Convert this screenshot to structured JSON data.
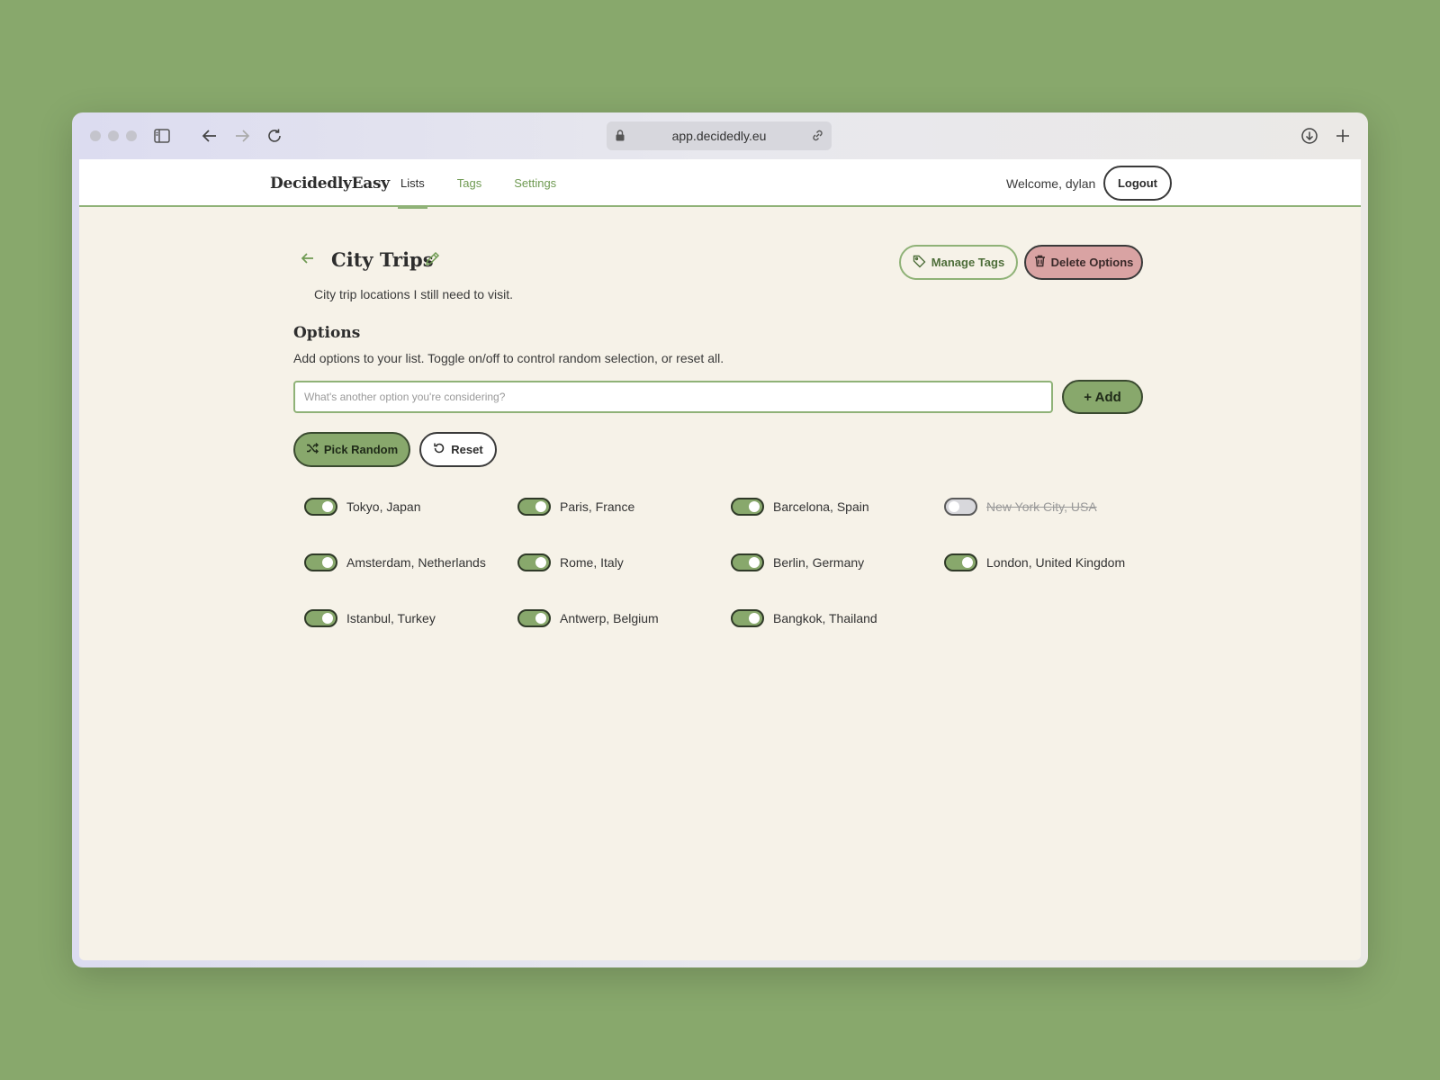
{
  "browser": {
    "url": "app.decidedly.eu"
  },
  "header": {
    "brand": "DecidedlyEasy",
    "nav": [
      {
        "label": "Lists",
        "active": true
      },
      {
        "label": "Tags",
        "active": false
      },
      {
        "label": "Settings",
        "active": false
      }
    ],
    "welcome": "Welcome, dylan",
    "logout_label": "Logout"
  },
  "list": {
    "title": "City Trips",
    "description": "City trip locations I still need to visit.",
    "manage_tags_label": "Manage Tags",
    "delete_options_label": "Delete Options"
  },
  "options_section": {
    "title": "Options",
    "help": "Add options to your list. Toggle on/off to control random selection, or reset all.",
    "input_placeholder": "What's another option you're considering?",
    "add_label": "+ Add",
    "pick_random_label": "Pick Random",
    "reset_label": "Reset"
  },
  "options": [
    {
      "label": "Tokyo, Japan",
      "enabled": true
    },
    {
      "label": "Paris, France",
      "enabled": true
    },
    {
      "label": "Barcelona, Spain",
      "enabled": true
    },
    {
      "label": "New York City, USA",
      "enabled": false
    },
    {
      "label": "Amsterdam, Netherlands",
      "enabled": true
    },
    {
      "label": "Rome, Italy",
      "enabled": true
    },
    {
      "label": "Berlin, Germany",
      "enabled": true
    },
    {
      "label": "London, United Kingdom",
      "enabled": true
    },
    {
      "label": "Istanbul, Turkey",
      "enabled": true
    },
    {
      "label": "Antwerp, Belgium",
      "enabled": true
    },
    {
      "label": "Bangkok, Thailand",
      "enabled": true
    }
  ],
  "colors": {
    "accent_green": "#88a86c",
    "danger_pink": "#d9a3a3",
    "page_background": "#f6f2e8"
  }
}
